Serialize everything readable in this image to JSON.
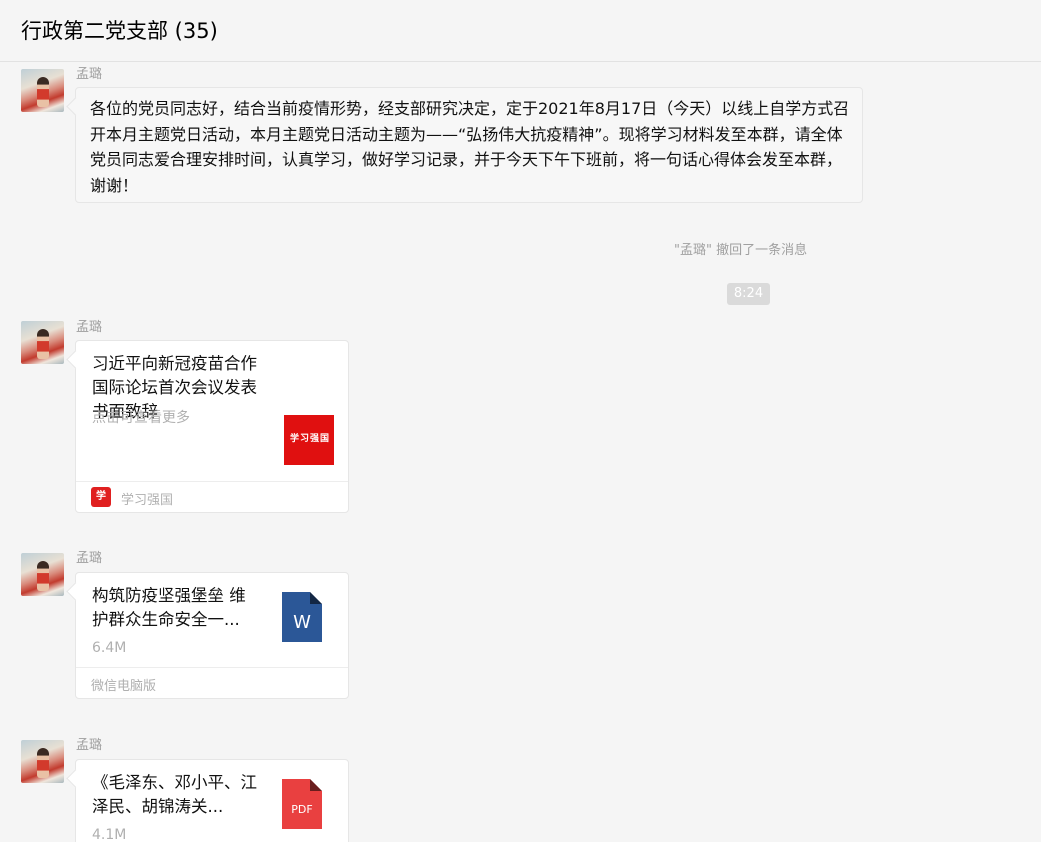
{
  "header": {
    "title": "行政第二党支部 (35)"
  },
  "messages": [
    {
      "sender": "孟璐",
      "text": "各位的党员同志好，结合当前疫情形势，经支部研究决定，定于2021年8月17日（今天）以线上自学方式召开本月主题党日活动，本月主题党日活动主题为——“弘扬伟大抗疫精神”。现将学习材料发至本群，请全体党员同志爱合理安排时间，认真学习，做好学习记录，并于今天下午下班前，将一句话心得体会发至本群，谢谢！"
    },
    {
      "sender": "孟璐",
      "title": "习近平向新冠疫苗合作国际论坛首次会议发表书面致辞",
      "subtitle": "点击可查看更多",
      "source": "学习强国",
      "thumb_text": "学习强国",
      "thumb_color": "#e01010"
    },
    {
      "sender": "孟璐",
      "title": "构筑防疫坚强堡垒 维护群众生命安全一...",
      "size": "6.4M",
      "source": "微信电脑版",
      "file_icon": "word-doc-icon",
      "file_label": "W",
      "file_color": "#2b5797"
    },
    {
      "sender": "孟璐",
      "title": "《毛泽东、邓小平、江泽民、胡锦涛关...",
      "size": "4.1M",
      "file_icon": "pdf-file-icon",
      "file_label": "PDF",
      "file_color": "#e94040"
    }
  ],
  "system": {
    "recall_notice": "\"孟璐\" 撤回了一条消息",
    "time": "8:24"
  }
}
